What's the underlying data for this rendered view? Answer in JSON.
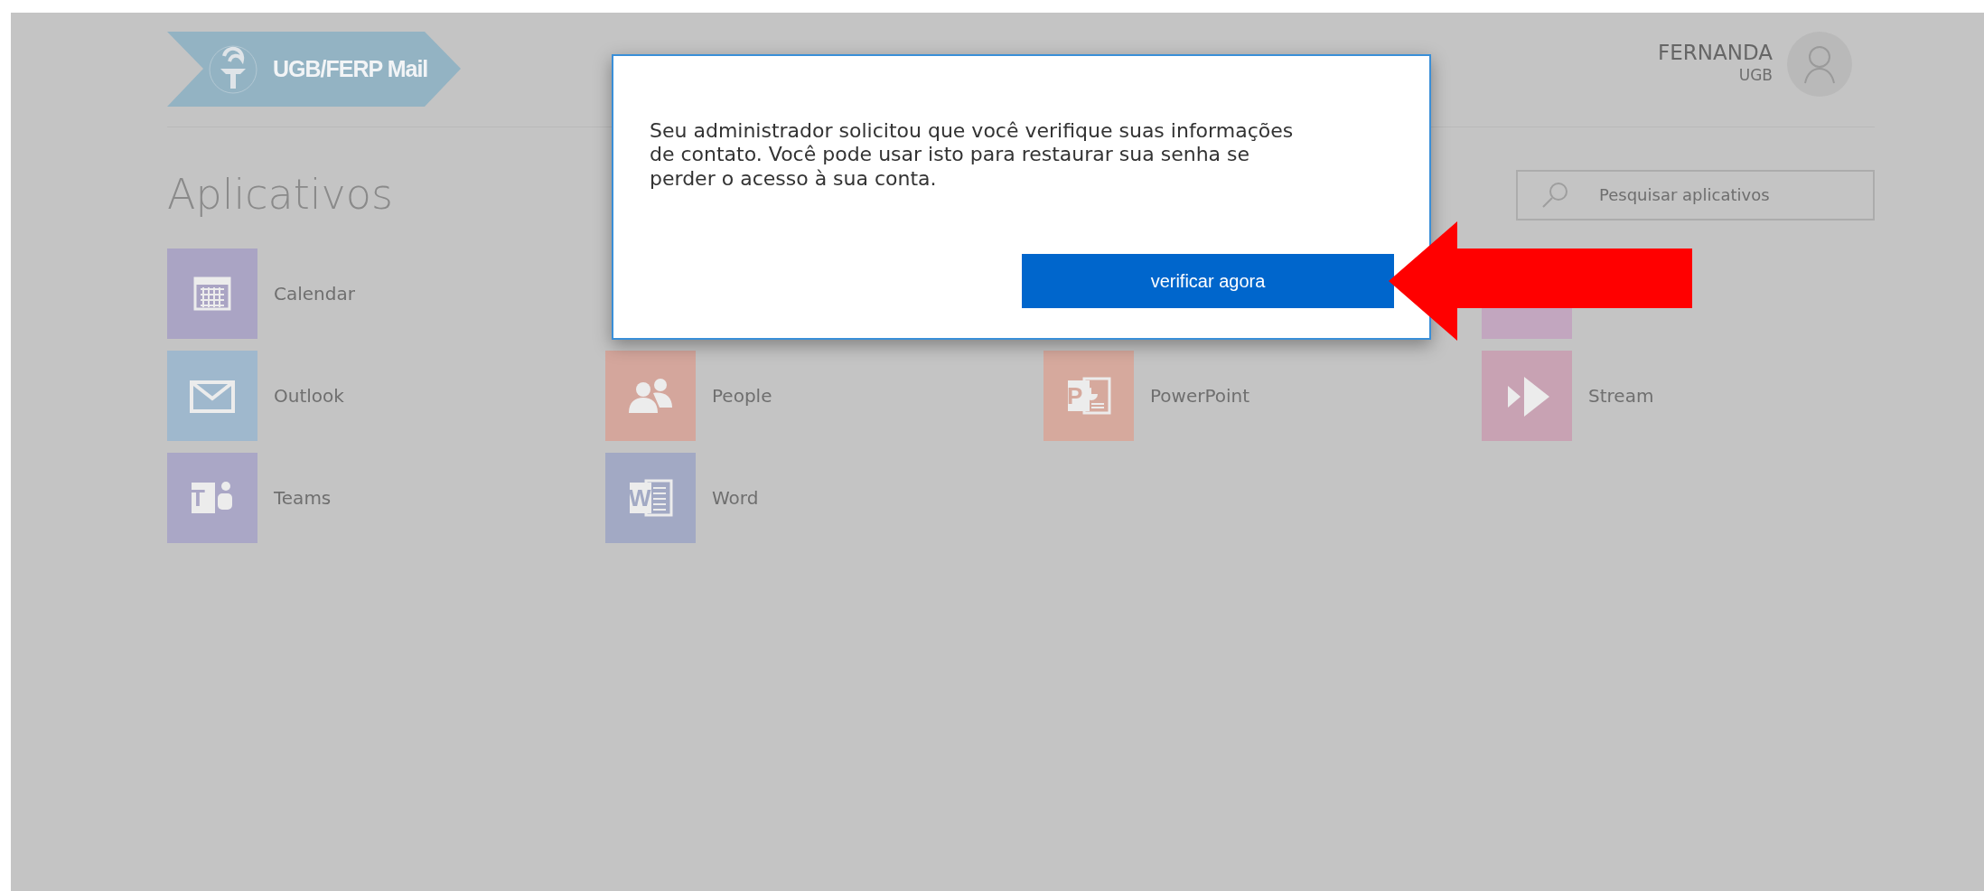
{
  "header": {
    "logo_text": "UGB/FERP Mail",
    "user_name": "FERNANDA",
    "user_org": "UGB"
  },
  "page_title": "Aplicativos",
  "search": {
    "placeholder": "Pesquisar aplicativos"
  },
  "app_rows": [
    [
      {
        "kind": "app",
        "label": "Calendar",
        "color": "#aaa4c4"
      },
      {
        "kind": "empty"
      },
      {
        "kind": "empty"
      },
      {
        "kind": "tile_partial",
        "color": "#c2a6bf"
      }
    ],
    [
      {
        "kind": "app",
        "label": "Outlook",
        "color": "#9fb8cd"
      },
      {
        "kind": "app",
        "label": "People",
        "color": "#d4a69c"
      },
      {
        "kind": "app",
        "glyph": "P",
        "label": "PowerPoint",
        "color": "#d6a99d"
      },
      {
        "kind": "app",
        "label": "Stream",
        "color": "#c8a2b3"
      }
    ],
    [
      {
        "kind": "app",
        "glyph": "T",
        "label": "Teams",
        "color": "#aaa7c6"
      },
      {
        "kind": "app",
        "glyph": "W",
        "label": "Word",
        "color": "#a2a9c4"
      },
      {
        "kind": "empty"
      },
      {
        "kind": "empty"
      }
    ]
  ],
  "dialog": {
    "message_lines": [
      "Seu administrador solicitou que você verifique suas informações",
      "de contato. Você pode usar isto para restaurar sua senha se",
      "perder o acesso à sua conta."
    ],
    "button": "verificar agora"
  }
}
